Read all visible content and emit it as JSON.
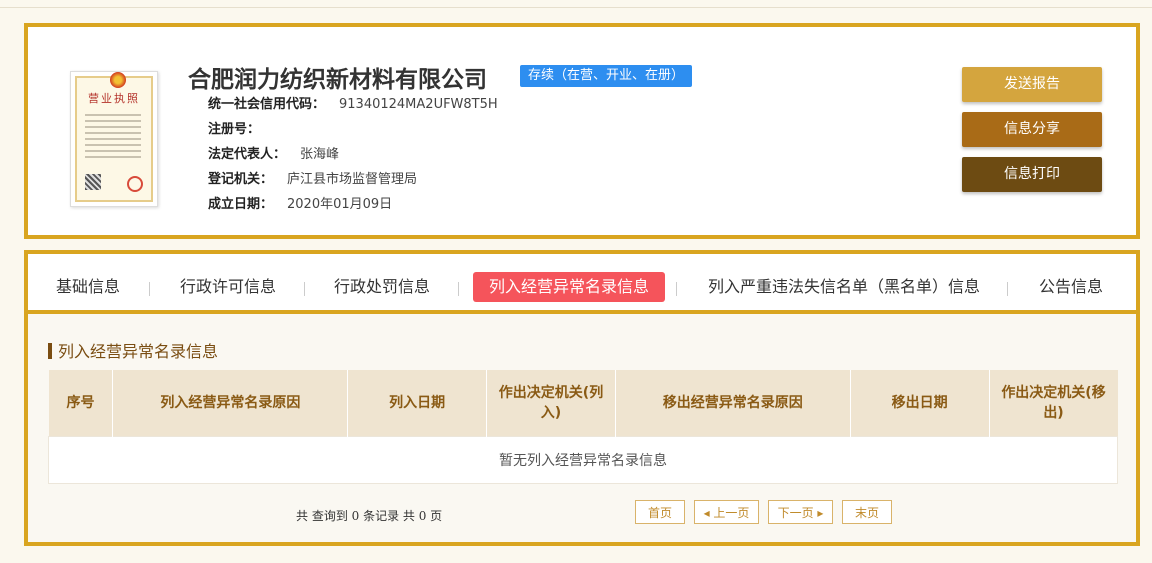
{
  "company": {
    "name": "合肥润力纺织新材料有限公司",
    "status": "存续（在营、开业、在册）",
    "fields": [
      {
        "key": "统一社会信用代码：",
        "value": "91340124MA2UFW8T5H"
      },
      {
        "key": "注册号：",
        "value": ""
      },
      {
        "key": "法定代表人：",
        "value": "张海峰"
      },
      {
        "key": "登记机关：",
        "value": "庐江县市场监督管理局"
      },
      {
        "key": "成立日期：",
        "value": "2020年01月09日"
      }
    ],
    "license_title": "营业执照"
  },
  "actions": {
    "send": "发送报告",
    "share": "信息分享",
    "print": "信息打印"
  },
  "tabs": [
    "基础信息",
    "行政许可信息",
    "行政处罚信息",
    "列入经营异常名录信息",
    "列入严重违法失信名单（黑名单）信息",
    "公告信息"
  ],
  "active_tab_index": 3,
  "section": {
    "title": "列入经营异常名录信息",
    "columns": [
      "序号",
      "列入经营异常名录原因",
      "列入日期",
      "作出决定机关(列入)",
      "移出经营异常名录原因",
      "移出日期",
      "作出决定机关(移出)"
    ],
    "empty_message": "暂无列入经营异常名录信息"
  },
  "pager": {
    "info": "共 查询到 0 条记录 共 0 页",
    "first": "首页",
    "prev": "◂ 上一页",
    "next": "下一页 ▸",
    "last": "末页"
  },
  "colors": {
    "gold_border": "#d9a520",
    "badge_blue": "#2d8ef0",
    "active_tab": "#f5545b",
    "btn_send": "#d4a53e",
    "btn_share": "#a96b17",
    "btn_print": "#6d4b12"
  }
}
